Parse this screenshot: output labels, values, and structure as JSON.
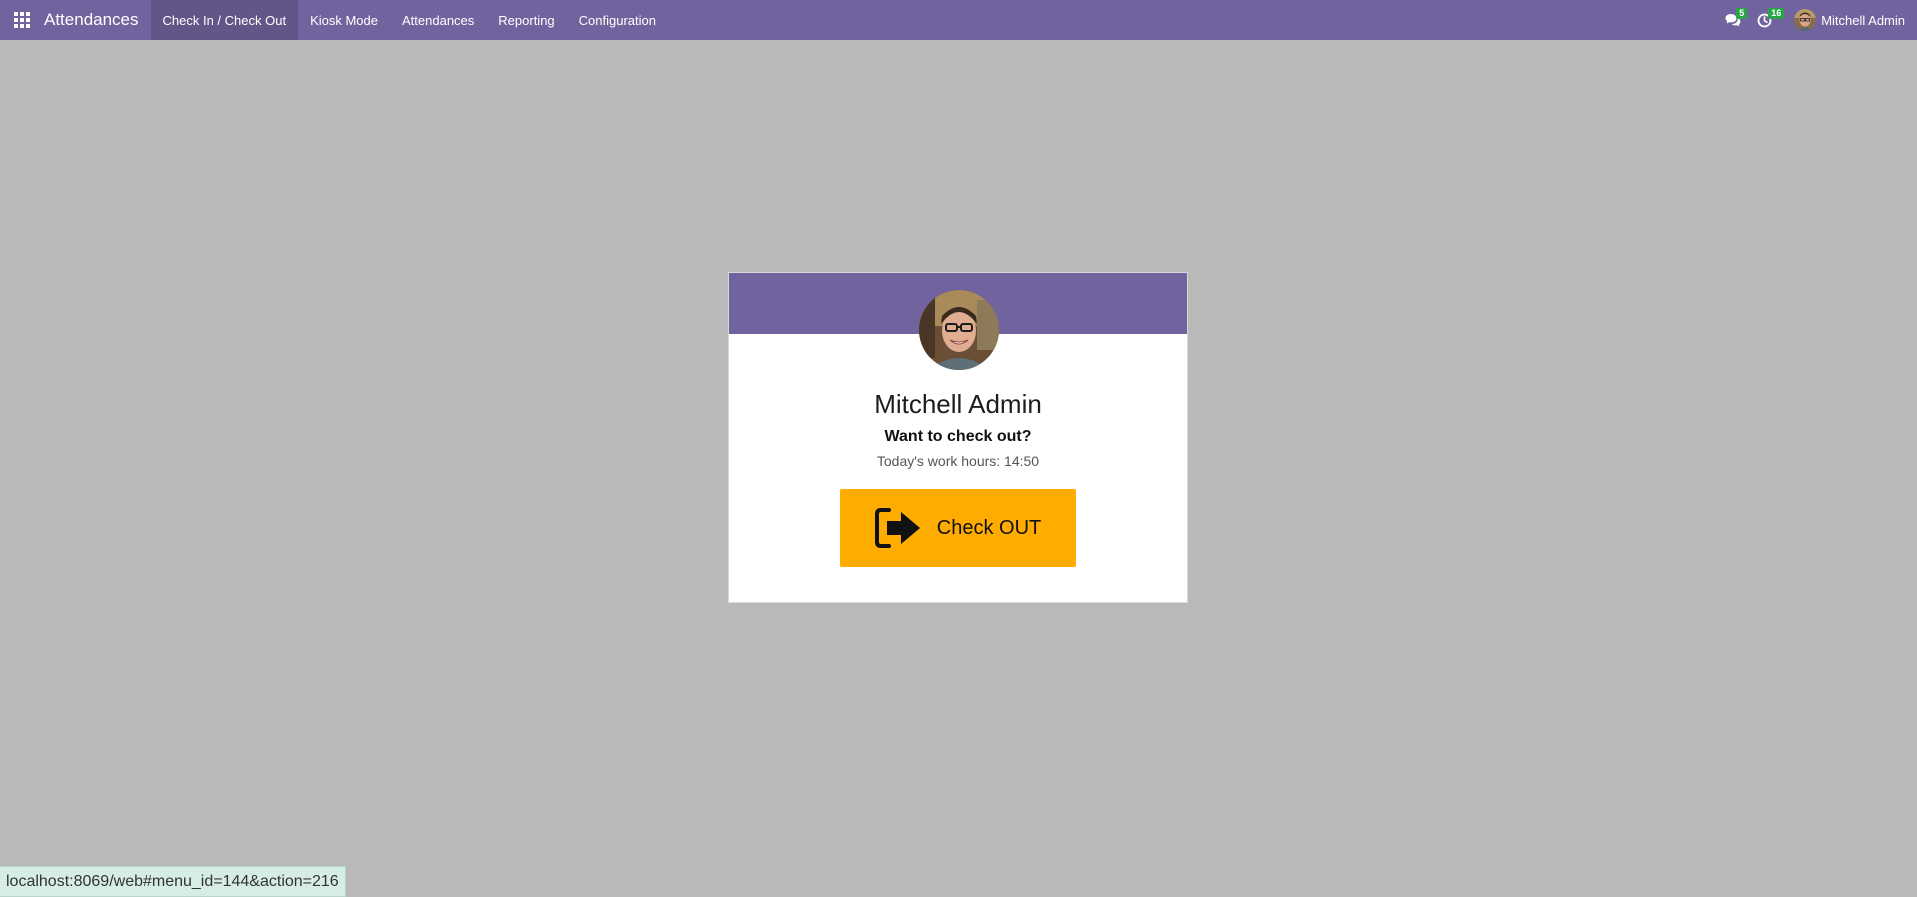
{
  "navbar": {
    "app_title": "Attendances",
    "menu": [
      {
        "label": "Check In / Check Out",
        "active": true
      },
      {
        "label": "Kiosk Mode"
      },
      {
        "label": "Attendances"
      },
      {
        "label": "Reporting"
      },
      {
        "label": "Configuration"
      }
    ],
    "messages_count": "5",
    "activities_count": "16",
    "user_name": "Mitchell Admin"
  },
  "card": {
    "employee_name": "Mitchell Admin",
    "question": "Want to check out?",
    "work_hours": "Today's work hours: 14:50",
    "button_label": "Check OUT"
  },
  "status_bar": {
    "url": "localhost:8069/web#menu_id=144&action=216"
  },
  "colors": {
    "navbar": "#71639e",
    "background": "#b8b9b8",
    "button": "#ffac00",
    "badge": "#28a745"
  },
  "icons": [
    "apps-grid-icon",
    "chat-icon",
    "clock-icon",
    "sign-out-icon"
  ]
}
